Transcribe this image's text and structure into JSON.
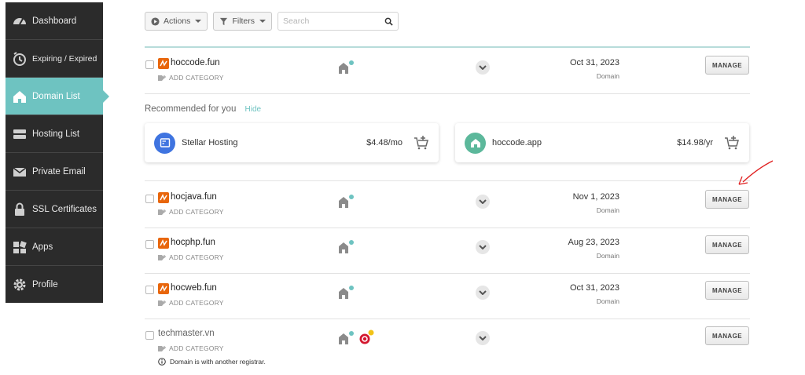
{
  "sidebar": {
    "items": [
      {
        "label": "Dashboard",
        "icon": "dashboard-icon"
      },
      {
        "label": "Expiring / Expired",
        "icon": "clock-icon"
      },
      {
        "label": "Domain List",
        "icon": "home-icon",
        "active": true
      },
      {
        "label": "Hosting List",
        "icon": "server-icon"
      },
      {
        "label": "Private Email",
        "icon": "mail-icon"
      },
      {
        "label": "SSL Certificates",
        "icon": "lock-icon"
      },
      {
        "label": "Apps",
        "icon": "apps-icon"
      },
      {
        "label": "Profile",
        "icon": "gear-icon"
      }
    ]
  },
  "toolbar": {
    "actions_label": "Actions",
    "filters_label": "Filters",
    "search_placeholder": "Search"
  },
  "recommended": {
    "heading": "Recommended for you",
    "hide_label": "Hide",
    "cards": [
      {
        "name": "Stellar Hosting",
        "price": "$4.48/mo",
        "color": "#3f74e0"
      },
      {
        "name": "hoccode.app",
        "price": "$14.98/yr",
        "color": "#5cb89b"
      }
    ]
  },
  "domains": [
    {
      "name": "hoccode.fun",
      "add_category": "ADD CATEGORY",
      "date": "Oct 31, 2023",
      "type": "Domain",
      "manage": "MANAGE"
    },
    {
      "name": "hocjava.fun",
      "add_category": "ADD CATEGORY",
      "date": "Nov 1, 2023",
      "type": "Domain",
      "manage": "MANAGE"
    },
    {
      "name": "hocphp.fun",
      "add_category": "ADD CATEGORY",
      "date": "Aug 23, 2023",
      "type": "Domain",
      "manage": "MANAGE"
    },
    {
      "name": "hocweb.fun",
      "add_category": "ADD CATEGORY",
      "date": "Oct 31, 2023",
      "type": "Domain",
      "manage": "MANAGE"
    },
    {
      "name": "techmaster.vn",
      "add_category": "ADD CATEGORY",
      "manage": "MANAGE",
      "note": "Domain is with another registrar."
    }
  ],
  "colors": {
    "accent": "#6ec3c1",
    "sidebar_bg": "#2b2b2b",
    "brand_orange": "#e8660c",
    "annotation_arrow": "#e02020"
  }
}
